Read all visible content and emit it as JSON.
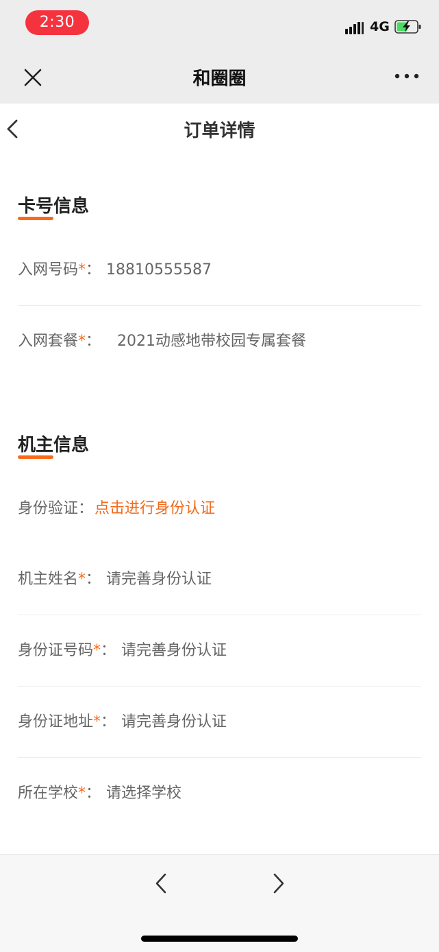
{
  "status_bar": {
    "time": "2:30",
    "network": "4G",
    "icons": [
      "signal-icon",
      "battery-charging-icon"
    ]
  },
  "app_bar": {
    "title": "和圈圈",
    "close_icon": "close-icon",
    "more_icon": "more-icon"
  },
  "page": {
    "title": "订单详情",
    "back_icon": "chevron-left-icon"
  },
  "card_section": {
    "title": "卡号信息",
    "rows": [
      {
        "label": "入网号码",
        "required": "*",
        "colon": "：",
        "value": "18810555587"
      },
      {
        "label": "入网套餐",
        "required": "*",
        "colon": "：",
        "value": "2021动感地带校园专属套餐"
      }
    ]
  },
  "owner_section": {
    "title": "机主信息",
    "verify_row": {
      "label": "身份验证",
      "colon": "：",
      "value": "点击进行身份认证"
    },
    "rows": [
      {
        "label": "机主姓名",
        "required": "*",
        "colon": "：",
        "value": "请完善身份认证"
      },
      {
        "label": "身份证号码",
        "required": "*",
        "colon": "：",
        "value": "请完善身份认证"
      },
      {
        "label": "身份证地址",
        "required": "*",
        "colon": "：",
        "value": "请完善身份认证"
      },
      {
        "label": "所在学校",
        "required": "*",
        "colon": "：",
        "value": "请选择学校"
      }
    ]
  },
  "browser_bar": {
    "back_icon": "chevron-left-icon",
    "forward_icon": "chevron-right-icon"
  },
  "colors": {
    "accent": "#fb6a18",
    "link": "#f26a1b",
    "time_pill": "#f5333f",
    "battery_fill": "#4cd964"
  }
}
